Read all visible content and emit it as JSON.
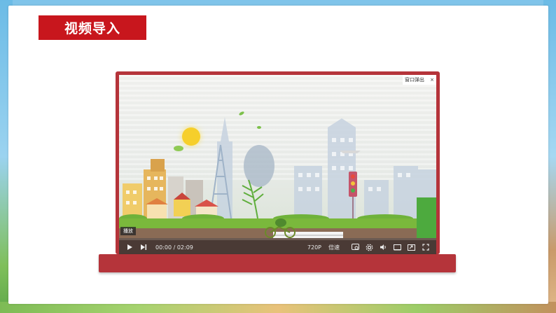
{
  "slide": {
    "title": "视频导入"
  },
  "player": {
    "popout_label": "窗口弹出",
    "close_glyph": "×",
    "play_tip": "播放",
    "time_current": "00:00",
    "time_separator": " / ",
    "time_total": "02:09",
    "quality": "720P",
    "speed": "倍速",
    "progress": 0
  },
  "colors": {
    "title_bg": "#c8161d",
    "frame": "#b5343a",
    "controls_bg": "#4a3a35"
  },
  "icons": [
    "play-icon",
    "next-icon",
    "danmaku-icon",
    "settings-icon",
    "volume-icon",
    "theater-mode-icon",
    "picture-in-picture-icon",
    "fullscreen-icon"
  ]
}
